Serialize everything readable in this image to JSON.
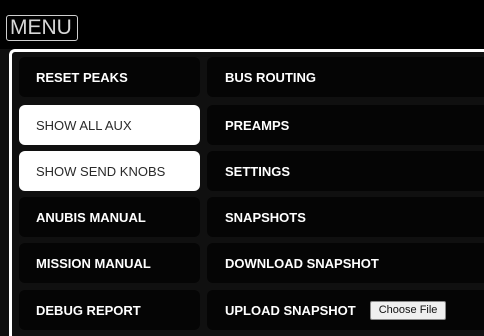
{
  "header": {
    "title": "MENU"
  },
  "menu": {
    "left": [
      {
        "label": "RESET PEAKS",
        "active": false
      },
      {
        "label": "SHOW ALL AUX",
        "active": true
      },
      {
        "label": "SHOW SEND KNOBS",
        "active": true
      },
      {
        "label": "ANUBIS MANUAL",
        "active": false
      },
      {
        "label": "MISSION MANUAL",
        "active": false
      },
      {
        "label": "DEBUG REPORT",
        "active": false
      }
    ],
    "right": [
      {
        "label": "BUS ROUTING"
      },
      {
        "label": "PREAMPS"
      },
      {
        "label": "SETTINGS"
      },
      {
        "label": "SNAPSHOTS"
      },
      {
        "label": "DOWNLOAD SNAPSHOT"
      },
      {
        "label": "UPLOAD SNAPSHOT"
      }
    ],
    "file_button_label": "Choose File"
  },
  "colors": {
    "background": "#0f0f0f",
    "button": "#050505",
    "active_button": "#ffffff",
    "text": "#ffffff",
    "active_text": "#2a2a2a"
  }
}
